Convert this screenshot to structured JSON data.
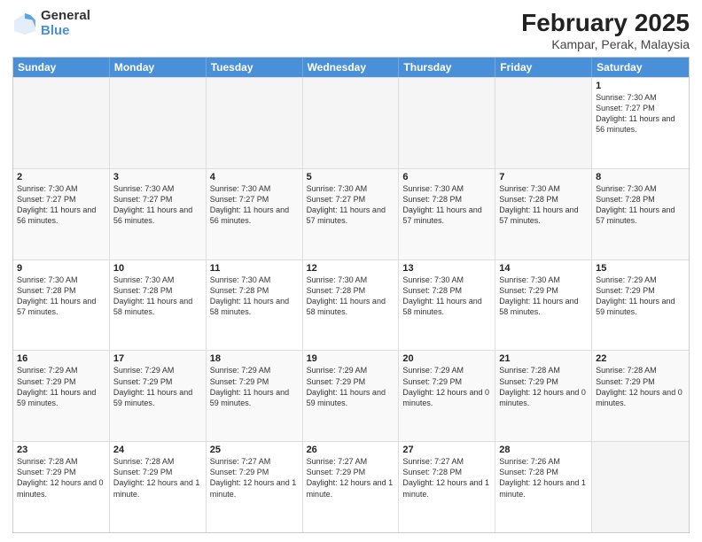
{
  "logo": {
    "general": "General",
    "blue": "Blue"
  },
  "title": "February 2025",
  "location": "Kampar, Perak, Malaysia",
  "header_days": [
    "Sunday",
    "Monday",
    "Tuesday",
    "Wednesday",
    "Thursday",
    "Friday",
    "Saturday"
  ],
  "weeks": [
    [
      {
        "day": "",
        "info": ""
      },
      {
        "day": "",
        "info": ""
      },
      {
        "day": "",
        "info": ""
      },
      {
        "day": "",
        "info": ""
      },
      {
        "day": "",
        "info": ""
      },
      {
        "day": "",
        "info": ""
      },
      {
        "day": "1",
        "info": "Sunrise: 7:30 AM\nSunset: 7:27 PM\nDaylight: 11 hours and 56 minutes."
      }
    ],
    [
      {
        "day": "2",
        "info": "Sunrise: 7:30 AM\nSunset: 7:27 PM\nDaylight: 11 hours and 56 minutes."
      },
      {
        "day": "3",
        "info": "Sunrise: 7:30 AM\nSunset: 7:27 PM\nDaylight: 11 hours and 56 minutes."
      },
      {
        "day": "4",
        "info": "Sunrise: 7:30 AM\nSunset: 7:27 PM\nDaylight: 11 hours and 56 minutes."
      },
      {
        "day": "5",
        "info": "Sunrise: 7:30 AM\nSunset: 7:27 PM\nDaylight: 11 hours and 57 minutes."
      },
      {
        "day": "6",
        "info": "Sunrise: 7:30 AM\nSunset: 7:28 PM\nDaylight: 11 hours and 57 minutes."
      },
      {
        "day": "7",
        "info": "Sunrise: 7:30 AM\nSunset: 7:28 PM\nDaylight: 11 hours and 57 minutes."
      },
      {
        "day": "8",
        "info": "Sunrise: 7:30 AM\nSunset: 7:28 PM\nDaylight: 11 hours and 57 minutes."
      }
    ],
    [
      {
        "day": "9",
        "info": "Sunrise: 7:30 AM\nSunset: 7:28 PM\nDaylight: 11 hours and 57 minutes."
      },
      {
        "day": "10",
        "info": "Sunrise: 7:30 AM\nSunset: 7:28 PM\nDaylight: 11 hours and 58 minutes."
      },
      {
        "day": "11",
        "info": "Sunrise: 7:30 AM\nSunset: 7:28 PM\nDaylight: 11 hours and 58 minutes."
      },
      {
        "day": "12",
        "info": "Sunrise: 7:30 AM\nSunset: 7:28 PM\nDaylight: 11 hours and 58 minutes."
      },
      {
        "day": "13",
        "info": "Sunrise: 7:30 AM\nSunset: 7:28 PM\nDaylight: 11 hours and 58 minutes."
      },
      {
        "day": "14",
        "info": "Sunrise: 7:30 AM\nSunset: 7:29 PM\nDaylight: 11 hours and 58 minutes."
      },
      {
        "day": "15",
        "info": "Sunrise: 7:29 AM\nSunset: 7:29 PM\nDaylight: 11 hours and 59 minutes."
      }
    ],
    [
      {
        "day": "16",
        "info": "Sunrise: 7:29 AM\nSunset: 7:29 PM\nDaylight: 11 hours and 59 minutes."
      },
      {
        "day": "17",
        "info": "Sunrise: 7:29 AM\nSunset: 7:29 PM\nDaylight: 11 hours and 59 minutes."
      },
      {
        "day": "18",
        "info": "Sunrise: 7:29 AM\nSunset: 7:29 PM\nDaylight: 11 hours and 59 minutes."
      },
      {
        "day": "19",
        "info": "Sunrise: 7:29 AM\nSunset: 7:29 PM\nDaylight: 11 hours and 59 minutes."
      },
      {
        "day": "20",
        "info": "Sunrise: 7:29 AM\nSunset: 7:29 PM\nDaylight: 12 hours and 0 minutes."
      },
      {
        "day": "21",
        "info": "Sunrise: 7:28 AM\nSunset: 7:29 PM\nDaylight: 12 hours and 0 minutes."
      },
      {
        "day": "22",
        "info": "Sunrise: 7:28 AM\nSunset: 7:29 PM\nDaylight: 12 hours and 0 minutes."
      }
    ],
    [
      {
        "day": "23",
        "info": "Sunrise: 7:28 AM\nSunset: 7:29 PM\nDaylight: 12 hours and 0 minutes."
      },
      {
        "day": "24",
        "info": "Sunrise: 7:28 AM\nSunset: 7:29 PM\nDaylight: 12 hours and 1 minute."
      },
      {
        "day": "25",
        "info": "Sunrise: 7:27 AM\nSunset: 7:29 PM\nDaylight: 12 hours and 1 minute."
      },
      {
        "day": "26",
        "info": "Sunrise: 7:27 AM\nSunset: 7:29 PM\nDaylight: 12 hours and 1 minute."
      },
      {
        "day": "27",
        "info": "Sunrise: 7:27 AM\nSunset: 7:28 PM\nDaylight: 12 hours and 1 minute."
      },
      {
        "day": "28",
        "info": "Sunrise: 7:26 AM\nSunset: 7:28 PM\nDaylight: 12 hours and 1 minute."
      },
      {
        "day": "",
        "info": ""
      }
    ]
  ]
}
